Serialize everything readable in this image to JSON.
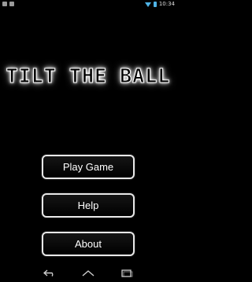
{
  "status_bar": {
    "time": "10:34",
    "icons": [
      "notification-icon",
      "notification-icon",
      "wifi-icon",
      "battery-icon"
    ],
    "accent": "#4fb3e6"
  },
  "title": "TILT THE BALL",
  "menu": {
    "play_label": "Play Game",
    "help_label": "Help",
    "about_label": "About"
  },
  "nav_bar": {
    "icons": [
      "back-icon",
      "home-icon",
      "recents-icon"
    ]
  }
}
